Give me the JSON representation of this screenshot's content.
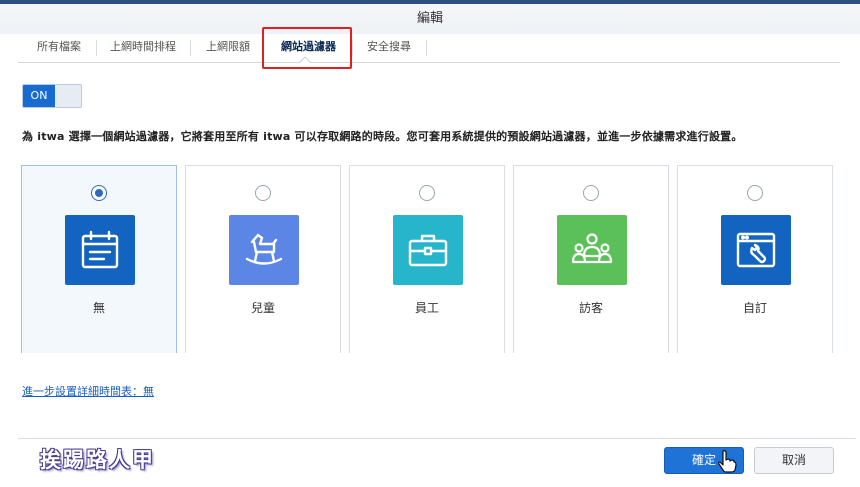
{
  "window": {
    "title": "編輯"
  },
  "tabs": [
    {
      "label": "所有檔案"
    },
    {
      "label": "上網時間排程"
    },
    {
      "label": "上網限額"
    },
    {
      "label": "網站過濾器",
      "active": true
    },
    {
      "label": "安全搜尋"
    }
  ],
  "toggle": {
    "label": "ON",
    "state": true
  },
  "description": "為 itwa 選擇一個網站過濾器，它將套用至所有 itwa 可以存取網路的時段。您可套用系統提供的預設網站過濾器，並進一步依據需求進行設置。",
  "filters": [
    {
      "label": "無",
      "selected": true,
      "icon": "calendar-icon",
      "color": "#1264c0"
    },
    {
      "label": "兒童",
      "selected": false,
      "icon": "rocking-horse-icon",
      "color": "#5b86e5"
    },
    {
      "label": "員工",
      "selected": false,
      "icon": "briefcase-icon",
      "color": "#27b5cc"
    },
    {
      "label": "訪客",
      "selected": false,
      "icon": "group-icon",
      "color": "#5cc05a"
    },
    {
      "label": "自訂",
      "selected": false,
      "icon": "browser-wrench-icon",
      "color": "#1264c0"
    }
  ],
  "schedule_link": "進一步設置詳細時間表：無",
  "watermark": "挨踢路人甲",
  "buttons": {
    "confirm": "確定",
    "cancel": "取消"
  }
}
